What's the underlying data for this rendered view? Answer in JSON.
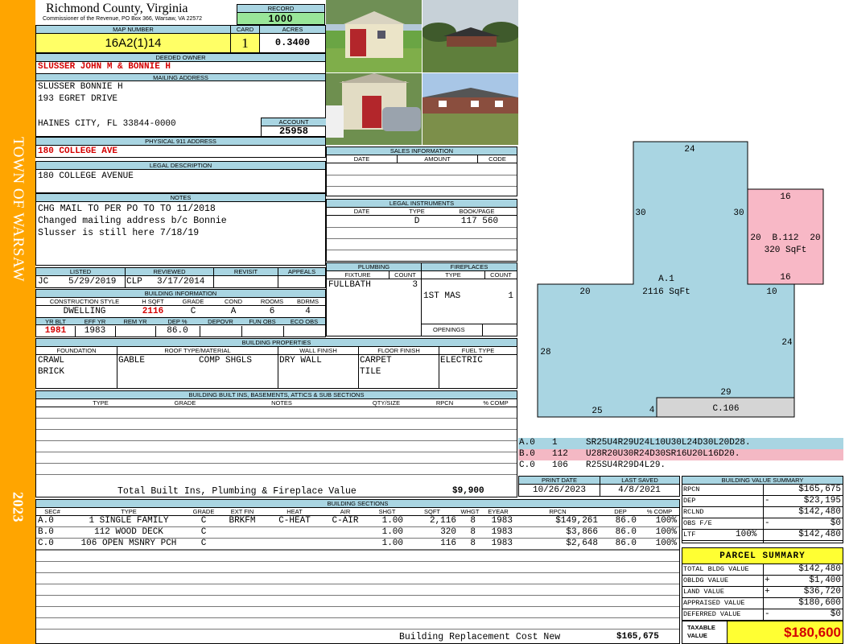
{
  "sidebar": {
    "town": "TOWN OF WARSAW",
    "year": "2023"
  },
  "header": {
    "county": "Richmond County, Virginia",
    "commissioner": "Commissioner of the Revenue, PO Box 366, Warsaw, VA 22572",
    "record_label": "RECORD",
    "record": "1000"
  },
  "parcel": {
    "map_label": "MAP NUMBER",
    "map": "16A2(1)14",
    "card_label": "CARD",
    "card": "1",
    "acres_label": "ACRES",
    "acres": "0.3400"
  },
  "owner": {
    "deeded_label": "DEEDED OWNER",
    "deeded": "SLUSSER JOHN M & BONNIE H",
    "mailing_label": "MAILING ADDRESS",
    "mail1": "SLUSSER BONNIE H",
    "mail2": "193 EGRET DRIVE",
    "mail3": "HAINES CITY, FL 33844-0000",
    "account_label": "ACCOUNT",
    "account": "25958"
  },
  "address": {
    "label": "PHYSICAL 911 ADDRESS",
    "value": "180 COLLEGE AVE"
  },
  "legal": {
    "label": "LEGAL DESCRIPTION",
    "value": "180 COLLEGE AVENUE"
  },
  "notes": {
    "label": "NOTES",
    "lines": [
      "CHG MAIL TO PER PO TO TO 11/2018",
      "Changed mailing address b/c Bonnie",
      "Slusser is still here 7/18/19"
    ]
  },
  "sales": {
    "label": "SALES INFORMATION",
    "cols": [
      "DATE",
      "AMOUNT",
      "CODE"
    ]
  },
  "instruments": {
    "label": "LEGAL INSTRUMENTS",
    "cols": [
      "DATE",
      "TYPE",
      "BOOK/PAGE"
    ],
    "row": {
      "type": "D",
      "book": "117 560"
    }
  },
  "review": {
    "cols": [
      "LISTED",
      "REVIEWED",
      "REVISIT",
      "APPEALS"
    ],
    "listed_by": "JC",
    "listed": "5/29/2019",
    "reviewed_by": "CLP",
    "reviewed": "3/17/2014"
  },
  "bldg_info": {
    "label": "BUILDING INFORMATION",
    "cols": [
      "CONSTRUCTION STYLE",
      "H SQFT",
      "GRADE",
      "COND",
      "ROOMS",
      "BDRMS"
    ],
    "style": "DWELLING",
    "hsqft": "2116",
    "grade": "C",
    "cond": "A",
    "rooms": "6",
    "bdrms": "4",
    "cols2": [
      "YR BLT",
      "EFF YR",
      "REM YR",
      "DEP %",
      "DEPOVR",
      "FUN OBS",
      "ECO OBS"
    ],
    "yrblt": "1981",
    "effyr": "1983",
    "dep": "86.0"
  },
  "plumbing": {
    "label": "PLUMBING",
    "cols": [
      "FIXTURE",
      "COUNT"
    ],
    "fixture": "FULLBATH",
    "count": "3"
  },
  "fireplaces": {
    "label": "FIREPLACES",
    "cols": [
      "TYPE",
      "COUNT"
    ],
    "type": "1ST MAS",
    "count": "1",
    "openings": "OPENINGS"
  },
  "props": {
    "label": "BUILDING PROPERTIES",
    "cols": [
      "FOUNDATION",
      "ROOF TYPE/MATERIAL",
      "WALL FINISH",
      "FLOOR FINISH",
      "FUEL TYPE"
    ],
    "foundation1": "CRAWL",
    "foundation2": "BRICK",
    "roof1": "GABLE",
    "roof2": "COMP SHGLS",
    "wall": "DRY WALL",
    "floor1": "CARPET",
    "floor2": "TILE",
    "fuel": "ELECTRIC"
  },
  "builtins": {
    "label": "BUILDING BUILT INS, BASEMENTS, ATTICS & SUB SECTIONS",
    "cols": [
      "TYPE",
      "GRADE",
      "NOTES",
      "QTY/SIZE",
      "RPCN",
      "% COMP"
    ],
    "total_label": "Total Built Ins, Plumbing & Fireplace Value",
    "total": "$9,900"
  },
  "dates": {
    "print_label": "PRINT DATE",
    "print": "10/26/2023",
    "saved_label": "LAST SAVED",
    "saved": "4/8/2021"
  },
  "sections": {
    "label": "BUILDING SECTIONS",
    "cols": [
      "SEC#",
      "TYPE",
      "GRADE",
      "EXT FIN",
      "HEAT",
      "AIR",
      "SHGT",
      "SQFT",
      "WHGT",
      "EYEAR",
      "RPCN",
      "DEP",
      "% COMP"
    ],
    "rows": [
      {
        "sec": "A.0",
        "type": "1 SINGLE FAMILY",
        "grade": "C",
        "ext": "BRKFM",
        "heat": "C-HEAT",
        "air": "C-AIR",
        "shgt": "1.00",
        "sqft": "2,116",
        "whgt": "8",
        "eyear": "1983",
        "rpcn": "$149,261",
        "dep": "86.0",
        "comp": "100%"
      },
      {
        "sec": "B.0",
        "type": "112 WOOD DECK",
        "grade": "C",
        "ext": "",
        "heat": "",
        "air": "",
        "shgt": "1.00",
        "sqft": "320",
        "whgt": "8",
        "eyear": "1983",
        "rpcn": "$3,866",
        "dep": "86.0",
        "comp": "100%"
      },
      {
        "sec": "C.0",
        "type": "106 OPEN MSNRY PCH",
        "grade": "C",
        "ext": "",
        "heat": "",
        "air": "",
        "shgt": "1.00",
        "sqft": "116",
        "whgt": "8",
        "eyear": "1983",
        "rpcn": "$2,648",
        "dep": "86.0",
        "comp": "100%"
      }
    ],
    "replacement_label": "Building Replacement Cost New",
    "replacement": "$165,675"
  },
  "sketch": {
    "a_label": "A.1",
    "a_area": "2116 SqFt",
    "b_label": "B.112",
    "b_area": "320 SqFt",
    "c_label": "C.106",
    "dims": {
      "a_top": "24",
      "a_left_upper": "30",
      "a_right_upper": "30",
      "a_mid_left": "20",
      "a_mid_right": "10",
      "a_left": "28",
      "a_right": "24",
      "a_bottom": "25",
      "a_notch": "4",
      "c_top": "29",
      "b_top": "16",
      "b_left": "20",
      "b_right": "20",
      "b_bottom": "16"
    },
    "legend": [
      {
        "code": "A.0",
        "num": "1",
        "desc": "SR25U4R29U24L10U30L24D30L20D28.",
        "color": "#a9d5e2"
      },
      {
        "code": "B.0",
        "num": "112",
        "desc": "U28R20U30R24D30SR16U20L16D20.",
        "color": "#f4b8c4"
      },
      {
        "code": "C.0",
        "num": "106",
        "desc": "R25SU4R29D4L29.",
        "color": "#d8d8d8"
      }
    ],
    "colors": {
      "a": "#a9d5e2",
      "b": "#f8b8c6",
      "c": "#d5d5d5"
    }
  },
  "value_summary": {
    "label": "BUILDING VALUE SUMMARY",
    "rows": [
      {
        "k": "RPCN",
        "op": "",
        "v": "$165,675"
      },
      {
        "k": "DEP",
        "op": "-",
        "v": "$23,195"
      },
      {
        "k": "RCLND",
        "op": "",
        "v": "$142,480"
      },
      {
        "k": "OBS F/E",
        "op": "-",
        "v": "$0"
      },
      {
        "k": "LTF",
        "op": "100%",
        "v": "$142,480"
      }
    ]
  },
  "parcel_summary": {
    "label": "PARCEL SUMMARY",
    "rows": [
      {
        "k": "TOTAL BLDG VALUE",
        "op": "",
        "v": "$142,480"
      },
      {
        "k": "OBLDG VALUE",
        "op": "+",
        "v": "$1,400"
      },
      {
        "k": "LAND VALUE",
        "op": "+",
        "v": "$36,720"
      },
      {
        "k": "APPRAISED VALUE",
        "op": "",
        "v": "$180,600"
      },
      {
        "k": "DEFERRED VALUE",
        "op": "-",
        "v": "$0"
      }
    ],
    "taxable_label": "TAXABLE VALUE",
    "taxable": "$180,600"
  }
}
